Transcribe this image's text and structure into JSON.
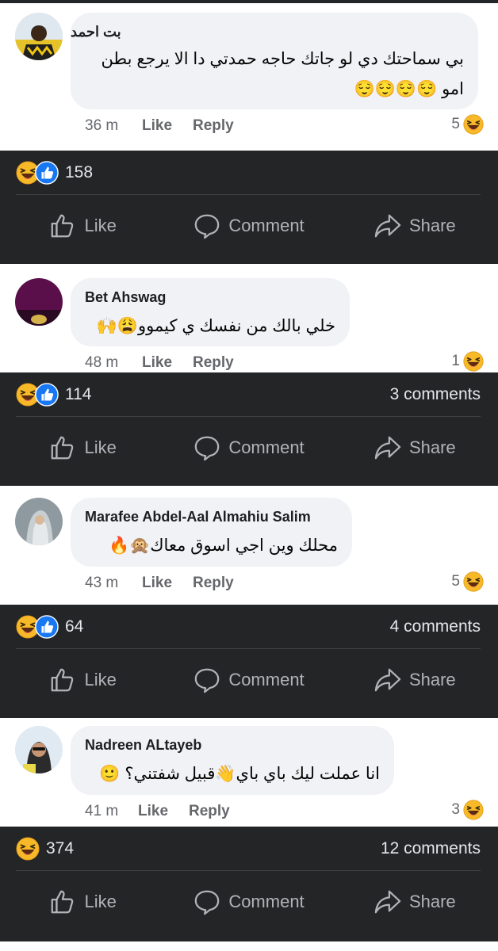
{
  "comments": [
    {
      "author": "بت احمد",
      "line1": "بي سماحتك دي لو جاتك حاجه حمدتي دا الا يرجع بطن",
      "line2": "امو 😌😌😌😌",
      "time": "36 m",
      "like": "Like",
      "reply": "Reply",
      "reactions": "5"
    },
    {
      "author": "Bet Ahswag",
      "line1": "خلي بالك من نفسك ي كيموو😩🙌",
      "time": "48 m",
      "like": "Like",
      "reply": "Reply",
      "reactions": "1"
    },
    {
      "author": "Marafee Abdel-Aal Almahiu Salim",
      "line1": "محلك وين اجي اسوق معاك🙊🔥",
      "time": "43 m",
      "like": "Like",
      "reply": "Reply",
      "reactions": "5"
    },
    {
      "author": "Nadreen ALtayeb",
      "line1": "انا عملت ليك باي باي👋قبيل شفتني؟ 🙂",
      "time": "41 m",
      "like": "Like",
      "reply": "Reply",
      "reactions": "3"
    }
  ],
  "posts": [
    {
      "reaction_count": "158",
      "comments_count": "",
      "like": "Like",
      "comment": "Comment",
      "share": "Share"
    },
    {
      "reaction_count": "114",
      "comments_count": "3 comments",
      "like": "Like",
      "comment": "Comment",
      "share": "Share"
    },
    {
      "reaction_count": "64",
      "comments_count": "4 comments",
      "like": "Like",
      "comment": "Comment",
      "share": "Share"
    },
    {
      "reaction_count": "374",
      "comments_count": "12 comments",
      "like": "Like",
      "comment": "Comment",
      "share": "Share"
    }
  ],
  "icons": {
    "haha": "haha-reaction-icon",
    "like_reaction": "like-reaction-icon",
    "like_action": "thumbs-up-icon",
    "comment_action": "speech-bubble-icon",
    "share_action": "share-arrow-icon"
  },
  "colors": {
    "dark_bar": "#242526",
    "comment_bubble": "#f0f2f5",
    "like_blue": "#1877f2",
    "haha_yellow": "#f7b928"
  }
}
